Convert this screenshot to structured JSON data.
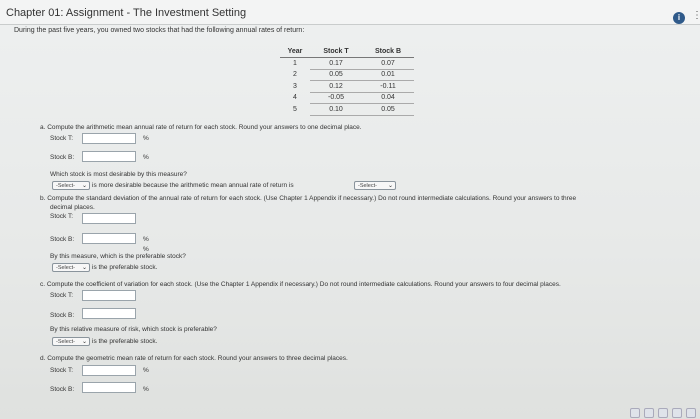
{
  "header": {
    "title": "Chapter 01: Assignment - The Investment Setting"
  },
  "intro": "During the past five years, you owned two stocks that had the following annual rates of return:",
  "table": {
    "headers": [
      "Year",
      "Stock T",
      "Stock B"
    ],
    "rows": [
      [
        "1",
        "0.17",
        "0.07"
      ],
      [
        "2",
        "0.05",
        "0.01"
      ],
      [
        "3",
        "0.12",
        "-0.11"
      ],
      [
        "4",
        "-0.05",
        "0.04"
      ],
      [
        "5",
        "0.10",
        "0.05"
      ]
    ]
  },
  "part_a": {
    "prompt": "a. Compute the arithmetic mean annual rate of return for each stock. Round your answers to one decimal place.",
    "stock_t_label": "Stock T:",
    "stock_b_label": "Stock B:",
    "unit": "%",
    "which_q": "Which stock is most desirable by this measure?",
    "select_label": "-Select-",
    "sentence": "is more desirable because the arithmetic mean annual rate of return is"
  },
  "part_b": {
    "prompt": "b. Compute the standard deviation of the annual rate of return for each stock. (Use Chapter 1 Appendix if necessary.) Do not round intermediate calculations. Round your answers to three",
    "prompt2": "decimal places.",
    "stock_t_label": "Stock T:",
    "stock_b_label": "Stock B:",
    "unit": "%",
    "which_q": "By this measure, which is the preferable stock?",
    "select_label": "-Select-",
    "sentence": "is the preferable stock."
  },
  "part_c": {
    "prompt": "c. Compute the coefficient of variation for each stock. (Use the Chapter 1 Appendix if necessary.) Do not round intermediate calculations. Round your answers to four decimal places.",
    "stock_t_label": "Stock T:",
    "stock_b_label": "Stock B:",
    "which_q": "By this relative measure of risk, which stock is preferable?",
    "select_label": "-Select-",
    "sentence": "is the preferable stock."
  },
  "part_d": {
    "prompt": "d. Compute the geometric mean rate of return for each stock. Round your answers to three decimal places.",
    "stock_t_label": "Stock T:",
    "stock_b_label": "Stock B:",
    "unit": "%"
  },
  "icons": {
    "info": "info-icon",
    "menu": "more-icon"
  }
}
